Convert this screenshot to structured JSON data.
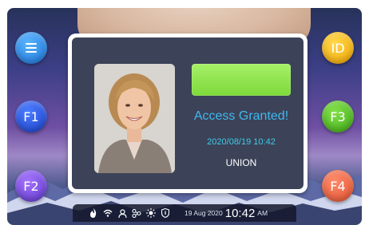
{
  "buttons": {
    "menu": {
      "icon": "menu-icon"
    },
    "f1": {
      "label": "F1"
    },
    "f2": {
      "label": "F2"
    },
    "id": {
      "label": "ID"
    },
    "f3": {
      "label": "F3"
    },
    "f4": {
      "label": "F4"
    }
  },
  "dialog": {
    "status_color": "#86de44",
    "access_message": "Access Granted!",
    "datetime": "2020/08/19 10:42",
    "company": "UNION"
  },
  "taskbar": {
    "icons": [
      "flame-icon",
      "wifi-icon",
      "user-icon",
      "network-icon",
      "brightness-icon",
      "shield-icon"
    ],
    "date": "19 Aug 2020",
    "time": "10:42",
    "ampm": "AM"
  },
  "colors": {
    "accent_text": "#3fb8f0",
    "dialog_bg": "#3c4257"
  }
}
